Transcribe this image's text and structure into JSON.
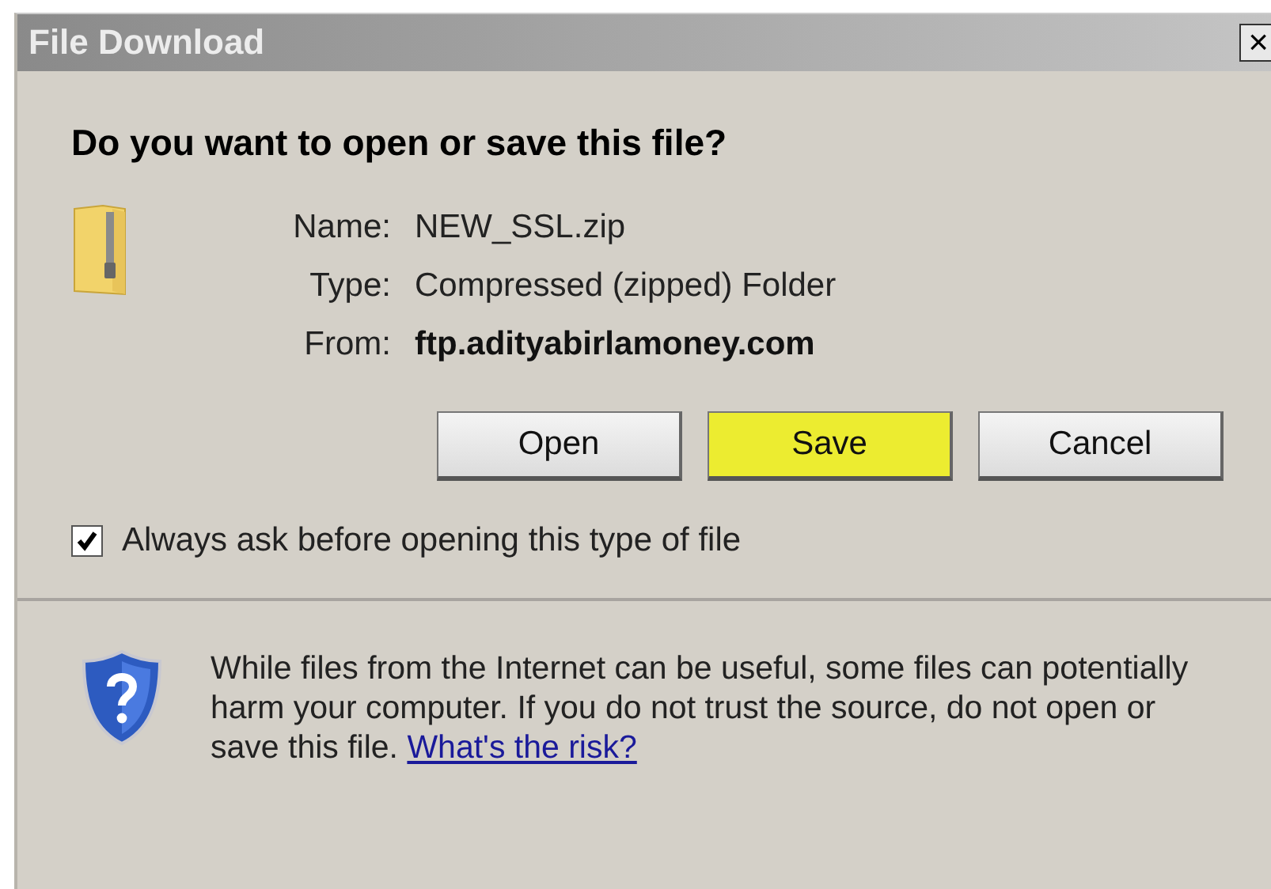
{
  "window": {
    "title": "File Download",
    "close": "×"
  },
  "heading": "Do you want to open or save this file?",
  "fields": [
    {
      "label": "Name:",
      "value": "NEW_SSL.zip",
      "bold": false
    },
    {
      "label": "Type:",
      "value": "Compressed (zipped) Folder",
      "bold": false
    },
    {
      "label": "From:",
      "value": "ftp.adityabirlamoney.com",
      "bold": true
    }
  ],
  "buttons": [
    {
      "label": "Open",
      "highlighted": false
    },
    {
      "label": "Save",
      "highlighted": true
    },
    {
      "label": "Cancel",
      "highlighted": false
    }
  ],
  "checkbox": {
    "label": "Always ask before opening this type of file",
    "checked": true
  },
  "warning": {
    "text": "While files from the Internet can be useful, some files can potentially harm your computer. If you do not trust the source, do not open or save this file.",
    "link": "What's the risk?"
  }
}
